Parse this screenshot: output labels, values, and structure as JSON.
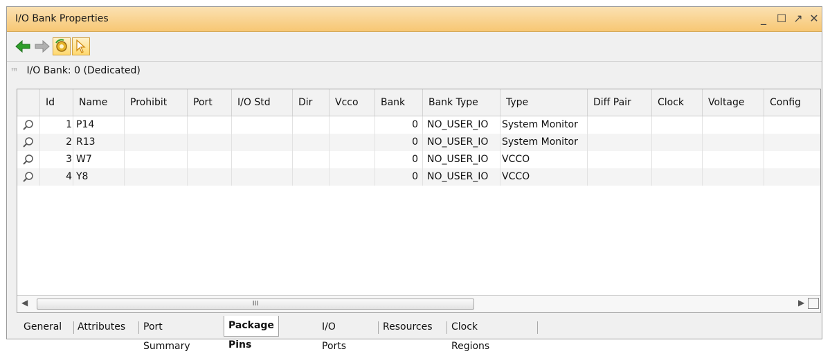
{
  "window": {
    "title": "I/O Bank Properties",
    "controls": {
      "minimize": "_",
      "maximize": "☐",
      "restore": "↗",
      "close": "✕"
    }
  },
  "toolbar": {
    "back_icon": "green-left-arrow",
    "forward_icon": "gray-right-arrow",
    "auto_update_icon": "gear-sync-icon",
    "select_icon": "cursor-icon"
  },
  "bank": {
    "label": "I/O Bank: 0 (Dedicated)",
    "icon": "io-bank-icon"
  },
  "table": {
    "columns": [
      "Id",
      "Name",
      "Prohibit",
      "Port",
      "I/O Std",
      "Dir",
      "Vcco",
      "Bank",
      "Bank Type",
      "Type",
      "Diff Pair",
      "Clock",
      "Voltage",
      "Config"
    ],
    "rows": [
      {
        "id": "1",
        "name": "P14",
        "prohibit": "",
        "port": "",
        "io_std": "",
        "dir": "",
        "vcco": "",
        "bank": "0",
        "bank_type": "NO_USER_IO",
        "type": "System Monitor",
        "diff_pair": "",
        "clock": "",
        "voltage": "",
        "config": ""
      },
      {
        "id": "2",
        "name": "R13",
        "prohibit": "",
        "port": "",
        "io_std": "",
        "dir": "",
        "vcco": "",
        "bank": "0",
        "bank_type": "NO_USER_IO",
        "type": "System Monitor",
        "diff_pair": "",
        "clock": "",
        "voltage": "",
        "config": ""
      },
      {
        "id": "3",
        "name": "W7",
        "prohibit": "",
        "port": "",
        "io_std": "",
        "dir": "",
        "vcco": "",
        "bank": "0",
        "bank_type": "NO_USER_IO",
        "type": "VCCO",
        "diff_pair": "",
        "clock": "",
        "voltage": "",
        "config": ""
      },
      {
        "id": "4",
        "name": "Y8",
        "prohibit": "",
        "port": "",
        "io_std": "",
        "dir": "",
        "vcco": "",
        "bank": "0",
        "bank_type": "NO_USER_IO",
        "type": "VCCO",
        "diff_pair": "",
        "clock": "",
        "voltage": "",
        "config": ""
      }
    ],
    "scroll_thumb_label": "III"
  },
  "tabs": [
    {
      "label": "General",
      "selected": false
    },
    {
      "label": "Attributes",
      "selected": false
    },
    {
      "label": "Port Summary",
      "selected": false
    },
    {
      "label": "Package Pins",
      "selected": true
    },
    {
      "label": "I/O Ports",
      "selected": false
    },
    {
      "label": "Resources",
      "selected": false
    },
    {
      "label": "Clock Regions",
      "selected": false
    }
  ],
  "colors": {
    "titlebar": "#f7c774",
    "accent_green": "#2e9e2a",
    "selected_tab_bg": "#ffffff"
  }
}
